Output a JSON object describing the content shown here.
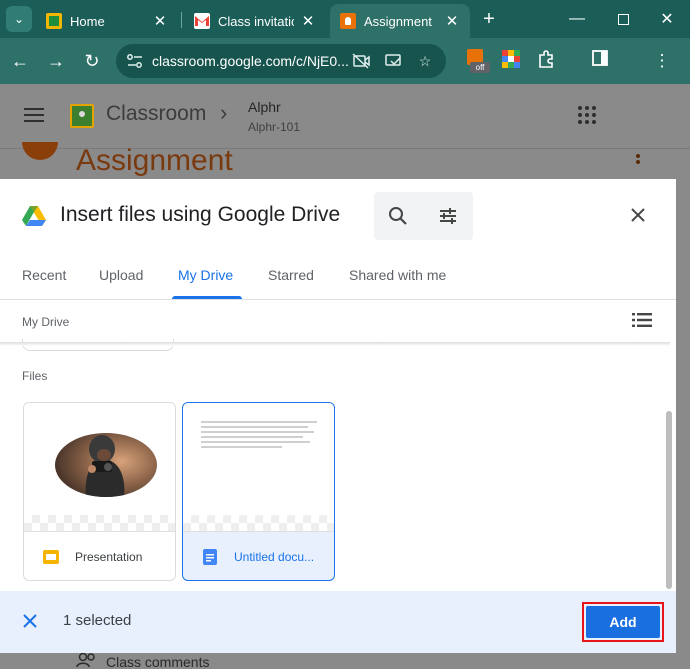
{
  "browser": {
    "tabs": [
      {
        "title": "Home",
        "close": "✕"
      },
      {
        "title": "Class invitation",
        "close": "✕"
      },
      {
        "title": "Assignment",
        "close": "✕"
      }
    ],
    "new_tab": "+",
    "url": "classroom.google.com/c/NjE0...",
    "extension_badge": "off",
    "colors": {
      "frame": "#1b5e57",
      "toolbar": "#2e7169",
      "omnibox": "#17544d"
    }
  },
  "classroom": {
    "app_name": "Classroom",
    "course_name": "Alphr",
    "course_section": "Alphr-101",
    "page_title": "Assignment",
    "class_comments": "Class comments"
  },
  "dialog": {
    "title": "Insert files using Google Drive",
    "tabs": [
      {
        "label": "Recent"
      },
      {
        "label": "Upload"
      },
      {
        "label": "My Drive"
      },
      {
        "label": "Starred"
      },
      {
        "label": "Shared with me"
      }
    ],
    "active_tab": "My Drive",
    "breadcrumb": "My Drive",
    "section_label": "Files",
    "files": [
      {
        "name": "Presentation",
        "type": "slides",
        "selected": false
      },
      {
        "name": "Untitled docu...",
        "type": "document",
        "selected": true
      }
    ],
    "footer": {
      "selected_text": "1 selected",
      "add_label": "Add"
    },
    "colors": {
      "accent": "#1a73e8",
      "add_button": "#1a6fe0",
      "highlight_outline": "#e8141a"
    }
  }
}
